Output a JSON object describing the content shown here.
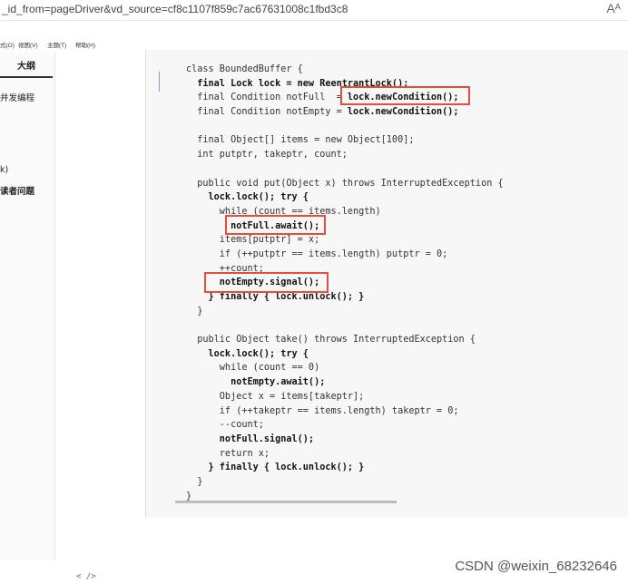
{
  "browser": {
    "url_fragment": "_id_from=pageDriver&vd_source=cf8c1107f859c7ac67631008c1fbd3c8",
    "reader_icon": "reader-mode-icon",
    "reader_glyph": "Aᴬ"
  },
  "menubar": [
    "式(O)",
    "视图(V)",
    "主题(T)",
    "帮助(H)"
  ],
  "sidebar": {
    "tab_label": "大纲",
    "items": [
      "并发编程",
      "k)",
      "读者问题"
    ]
  },
  "code_lines": [
    {
      "segments": [
        {
          "t": "class BoundedBuffer {",
          "b": false
        }
      ]
    },
    {
      "segments": [
        {
          "t": "  final Lock lock = new ReentrantLock();",
          "b": true
        }
      ]
    },
    {
      "segments": [
        {
          "t": "  final Condition notFull  = ",
          "b": false
        },
        {
          "t": "lock.newCondition();",
          "b": true
        }
      ]
    },
    {
      "segments": [
        {
          "t": "  final Condition notEmpty = ",
          "b": false
        },
        {
          "t": "lock.newCondition();",
          "b": true
        }
      ]
    },
    {
      "segments": [
        {
          "t": "",
          "b": false
        }
      ]
    },
    {
      "segments": [
        {
          "t": "  final Object[] items = new Object[100];",
          "b": false
        }
      ]
    },
    {
      "segments": [
        {
          "t": "  int putptr, takeptr, count;",
          "b": false
        }
      ]
    },
    {
      "segments": [
        {
          "t": "",
          "b": false
        }
      ]
    },
    {
      "segments": [
        {
          "t": "  public void put(Object x) throws InterruptedException {",
          "b": false
        }
      ]
    },
    {
      "segments": [
        {
          "t": "    lock.lock(); try {",
          "b": true
        }
      ]
    },
    {
      "segments": [
        {
          "t": "      while (count == items.length)",
          "b": false
        }
      ]
    },
    {
      "segments": [
        {
          "t": "        notFull.await();",
          "b": true
        }
      ]
    },
    {
      "segments": [
        {
          "t": "      items[putptr] = x;",
          "b": false
        }
      ]
    },
    {
      "segments": [
        {
          "t": "      if (++putptr == items.length) putptr = 0;",
          "b": false
        }
      ]
    },
    {
      "segments": [
        {
          "t": "      ++count;",
          "b": false
        }
      ]
    },
    {
      "segments": [
        {
          "t": "      notEmpty.signal();",
          "b": true
        }
      ]
    },
    {
      "segments": [
        {
          "t": "    } finally { lock.unlock(); }",
          "b": true
        }
      ]
    },
    {
      "segments": [
        {
          "t": "  }",
          "b": false
        }
      ]
    },
    {
      "segments": [
        {
          "t": "",
          "b": false
        }
      ]
    },
    {
      "segments": [
        {
          "t": "  public Object take() throws InterruptedException {",
          "b": false
        }
      ]
    },
    {
      "segments": [
        {
          "t": "    lock.lock(); try {",
          "b": true
        }
      ]
    },
    {
      "segments": [
        {
          "t": "      while (count == 0)",
          "b": false
        }
      ]
    },
    {
      "segments": [
        {
          "t": "        notEmpty.await();",
          "b": true
        }
      ]
    },
    {
      "segments": [
        {
          "t": "      Object x = items[takeptr];",
          "b": false
        }
      ]
    },
    {
      "segments": [
        {
          "t": "      if (++takeptr == items.length) takeptr = 0;",
          "b": false
        }
      ]
    },
    {
      "segments": [
        {
          "t": "      --count;",
          "b": false
        }
      ]
    },
    {
      "segments": [
        {
          "t": "      notFull.signal();",
          "b": true
        }
      ]
    },
    {
      "segments": [
        {
          "t": "      return x;",
          "b": false
        }
      ]
    },
    {
      "segments": [
        {
          "t": "    } finally { lock.unlock(); }",
          "b": true
        }
      ]
    },
    {
      "segments": [
        {
          "t": "  }",
          "b": false
        }
      ]
    },
    {
      "segments": [
        {
          "t": "}",
          "b": false
        }
      ]
    }
  ],
  "footer": {
    "left_icons": "< />"
  },
  "watermark": "CSDN @weixin_68232646",
  "colors": {
    "highlight_box": "#e74c3c"
  }
}
